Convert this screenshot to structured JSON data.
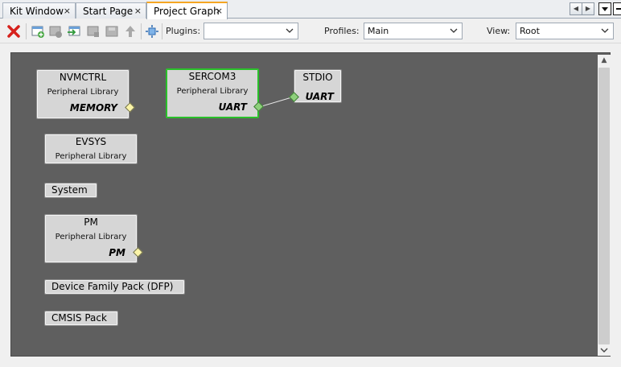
{
  "tabs": [
    {
      "label": "Kit Window",
      "close": "×"
    },
    {
      "label": "Start Page",
      "close": "×"
    },
    {
      "label": "Project Graph",
      "close": "×"
    }
  ],
  "toolbar": {
    "plugins_label": "Plugins:",
    "plugins_value": "",
    "profiles_label": "Profiles:",
    "profiles_value": "Main",
    "view_label": "View:",
    "view_value": "Root",
    "icons": [
      "close-red-x-icon",
      "add-component-icon",
      "remove-component-icon",
      "import-icon",
      "export-icon",
      "save-icon",
      "move-up-icon",
      "fit-to-window-icon"
    ]
  },
  "graph": {
    "nodes": [
      {
        "title": "NVMCTRL",
        "subtitle": "Peripheral Library",
        "port": "MEMORY"
      },
      {
        "title": "SERCOM3",
        "subtitle": "Peripheral Library",
        "port": "UART"
      },
      {
        "title": "STDIO",
        "subtitle": "",
        "port": "UART"
      },
      {
        "title": "EVSYS",
        "subtitle": "Peripheral Library",
        "port": ""
      },
      {
        "title": "System",
        "subtitle": "",
        "port": ""
      },
      {
        "title": "PM",
        "subtitle": "Peripheral Library",
        "port": "PM"
      },
      {
        "title": "Device Family Pack (DFP)",
        "subtitle": "",
        "port": ""
      },
      {
        "title": "CMSIS Pack",
        "subtitle": "",
        "port": ""
      }
    ]
  },
  "colors": {
    "canvas_bg": "#5f5f5f",
    "node_bg": "#d6d6d6",
    "selected_border": "#2ac12a",
    "active_tab_accent": "#f5a623"
  }
}
